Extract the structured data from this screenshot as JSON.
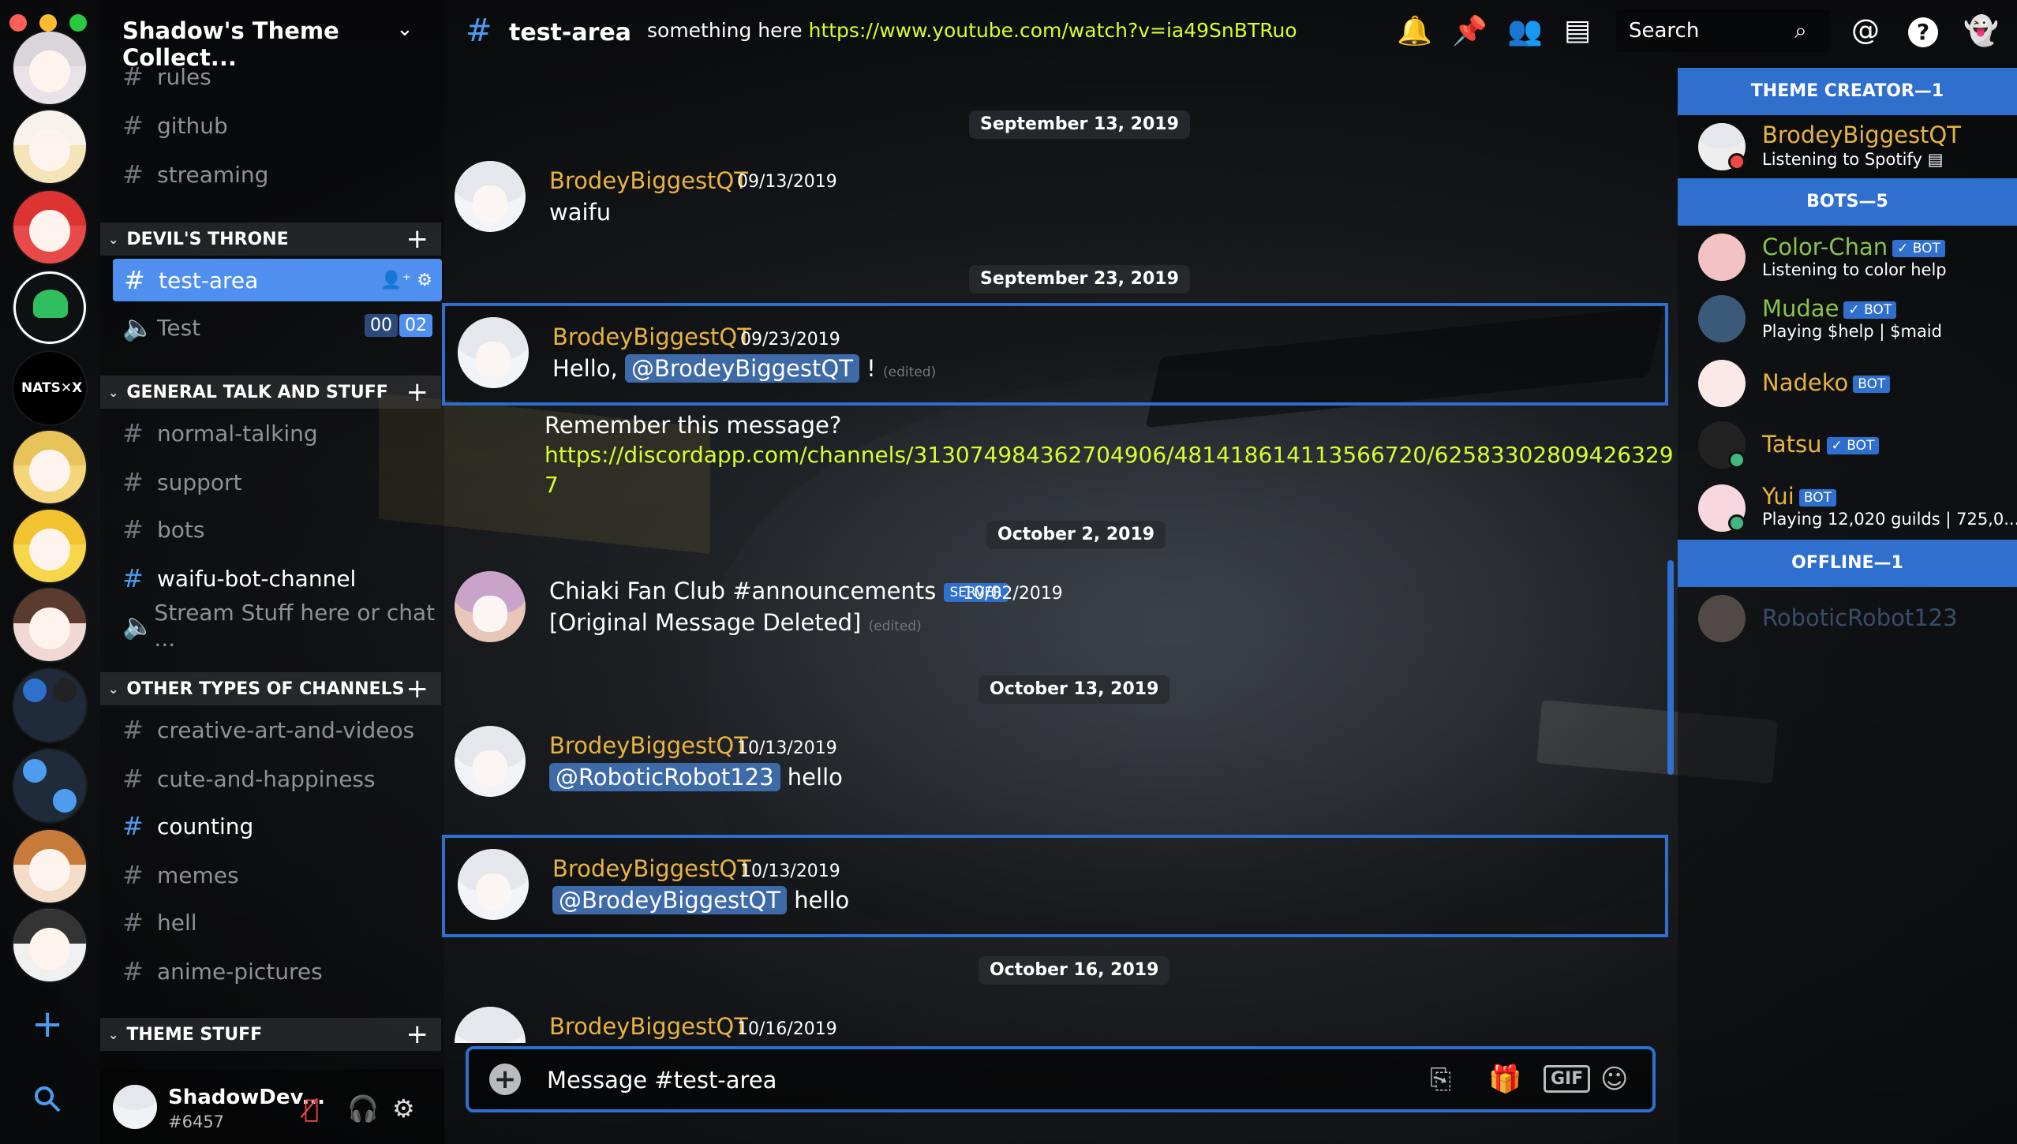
{
  "window": {
    "traffic_colors": [
      "#ff5f57",
      "#febc2e",
      "#28c840"
    ]
  },
  "server": {
    "name": "Shadow's Theme Collect..."
  },
  "channels": {
    "top": [
      {
        "name": "rules"
      },
      {
        "name": "github"
      },
      {
        "name": "streaming"
      }
    ],
    "categories": [
      {
        "name": "DEVIL'S THRONE"
      },
      {
        "name": "GENERAL TALK AND STUFF"
      },
      {
        "name": "OTHER TYPES OF CHANNELS"
      },
      {
        "name": "THEME STUFF"
      }
    ],
    "devils_throne": {
      "active": "test-area",
      "voice": "Test",
      "voice_badge": [
        "00",
        "02"
      ]
    },
    "general": [
      {
        "name": "normal-talking",
        "type": "text"
      },
      {
        "name": "support",
        "type": "text"
      },
      {
        "name": "bots",
        "type": "text"
      },
      {
        "name": "waifu-bot-channel",
        "type": "text"
      },
      {
        "name": "Stream Stuff here or chat ...",
        "type": "voice"
      }
    ],
    "other": [
      {
        "name": "creative-art-and-videos"
      },
      {
        "name": "cute-and-happiness"
      },
      {
        "name": "counting"
      },
      {
        "name": "memes"
      },
      {
        "name": "hell"
      },
      {
        "name": "anime-pictures"
      }
    ]
  },
  "user": {
    "name": "ShadowDev...",
    "tag": "#6457"
  },
  "header": {
    "channel": "test-area",
    "topic_prefix": "something here",
    "topic_link": "https://www.youtube.com/watch?v=ia49SnBTRuo",
    "search_placeholder": "Search"
  },
  "messages": [
    {
      "date": "September 13, 2019",
      "author": "BrodeyBiggestQT",
      "time": "09/13/2019",
      "text": "waifu"
    },
    {
      "date": "September 23, 2019",
      "author": "BrodeyBiggestQT",
      "time": "09/23/2019",
      "prefix": "Hello,",
      "mention": "@BrodeyBiggestQT",
      "suffix": "!",
      "edited": "(edited)",
      "followup": "Remember this message?",
      "link": "https://discordapp.com/channels/313074984362704906/481418614113566720/62583302809426329",
      "link_wrap": "7"
    },
    {
      "date": "October 2, 2019",
      "author": "Chiaki Fan Club #announcements",
      "badge": "SERVER",
      "time": "10/02/2019",
      "text": "[Original Message Deleted]",
      "edited": "(edited)"
    },
    {
      "date": "October 13, 2019",
      "author": "BrodeyBiggestQT",
      "time": "10/13/2019",
      "mention": "@RoboticRobot123",
      "text": "hello"
    },
    {
      "author": "BrodeyBiggestQT",
      "time": "10/13/2019",
      "mention": "@BrodeyBiggestQT",
      "text": "hello"
    },
    {
      "date": "October 16, 2019",
      "author": "BrodeyBiggestQT",
      "time": "10/16/2019"
    }
  ],
  "composer": {
    "placeholder": "Message #test-area",
    "gif_label": "GIF"
  },
  "members": {
    "roles": [
      {
        "label": "THEME CREATOR—1"
      },
      {
        "label": "BOTS—5"
      },
      {
        "label": "OFFLINE—1"
      }
    ],
    "creator": {
      "name": "BrodeyBiggestQT",
      "activity": "Listening to Spotify"
    },
    "bots": [
      {
        "name": "Color-Chan",
        "tag": "✓ BOT",
        "activity": "Listening to color help",
        "color": "#8bc34a"
      },
      {
        "name": "Mudae",
        "tag": "✓ BOT",
        "activity": "Playing $help | $maid",
        "color": "#8bc34a"
      },
      {
        "name": "Nadeko",
        "tag": "BOT",
        "activity": "",
        "color": "#e8b340"
      },
      {
        "name": "Tatsu",
        "tag": "✓ BOT",
        "activity": "",
        "color": "#e8b340"
      },
      {
        "name": "Yui",
        "tag": "BOT",
        "activity": "Playing 12,020 guilds | 725,0...",
        "color": "#e8b340"
      }
    ],
    "offline": [
      {
        "name": "RoboticRobot123"
      }
    ]
  },
  "colors": {
    "accent": "#2f6fce",
    "link": "#d6ff2d",
    "author": "#e8b340",
    "online": "#43b581",
    "dnd": "#f04747"
  },
  "icons": [
    "bell-icon",
    "pin-icon",
    "members-icon",
    "inbox-icon",
    "search-icon",
    "mention-icon",
    "help-icon",
    "ghost-icon",
    "add-server-icon",
    "explore-icon",
    "mute-icon",
    "headphones-icon",
    "settings-icon",
    "gift-icon",
    "translate-icon",
    "emoji-icon"
  ]
}
